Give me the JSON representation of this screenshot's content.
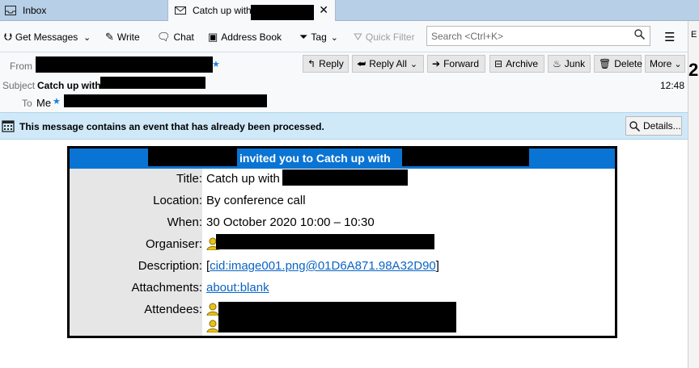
{
  "tabs": [
    {
      "label": "Inbox"
    },
    {
      "label": "Catch up with",
      "close": "✕"
    }
  ],
  "toolbar": {
    "get_messages": "Get Messages",
    "write": "Write",
    "chat": "Chat",
    "address_book": "Address Book",
    "tag": "Tag",
    "quick_filter": "Quick Filter",
    "search_placeholder": "Search <Ctrl+K>"
  },
  "header": {
    "from_label": "From",
    "subject_label": "Subject",
    "subject_value": "Catch up with",
    "to_label": "To",
    "to_value": "Me",
    "time": "12:48",
    "reply": "Reply",
    "reply_all": "Reply All",
    "forward": "Forward",
    "archive": "Archive",
    "junk": "Junk",
    "delete": "Delete",
    "more": "More"
  },
  "notification": {
    "text": "This message contains an event that has already been processed.",
    "details": "Details..."
  },
  "invite": {
    "header": "invited you to Catch up with",
    "rows": {
      "title_label": "Title:",
      "title_value": "Catch up with",
      "location_label": "Location:",
      "location_value": "By conference call",
      "when_label": "When:",
      "when_value": "30 October 2020 10:00 – 10:30",
      "organiser_label": "Organiser:",
      "description_label": "Description:",
      "description_value": "cid:image001.png@01D6A871.98A32D90",
      "attachments_label": "Attachments:",
      "attachments_value": "about:blank",
      "attendees_label": "Attendees:"
    }
  },
  "side": {
    "letter": "E",
    "number": "2"
  },
  "colors": {
    "tabstrip": "#b7cfe7",
    "notification": "#cfe9f9",
    "invite_header": "#0a74d4",
    "link": "#0a64c4"
  }
}
